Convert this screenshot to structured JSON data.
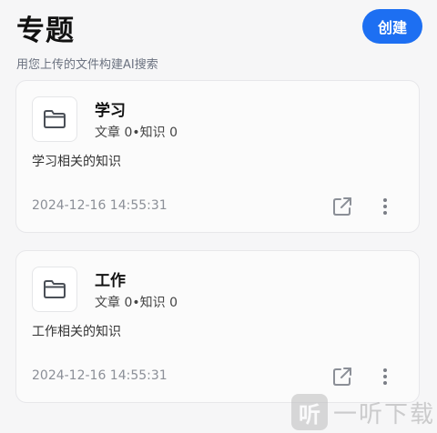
{
  "header": {
    "title": "专题",
    "subtitle": "用您上传的文件构建AI搜索",
    "create_label": "创建"
  },
  "cards": [
    {
      "name": "学习",
      "stats": "文章 0•知识 0",
      "description": "学习相关的知识",
      "date": "2024-12-16 14:55:31",
      "icon": "folder-icon"
    },
    {
      "name": "工作",
      "stats": "文章 0•知识 0",
      "description": "工作相关的知识",
      "date": "2024-12-16 14:55:31",
      "icon": "folder-icon"
    }
  ],
  "watermark": {
    "logo_char": "听",
    "text": "一听下载"
  },
  "colors": {
    "accent": "#1d6ff2",
    "background": "#f6f6f7",
    "card": "#fbfbfb"
  }
}
